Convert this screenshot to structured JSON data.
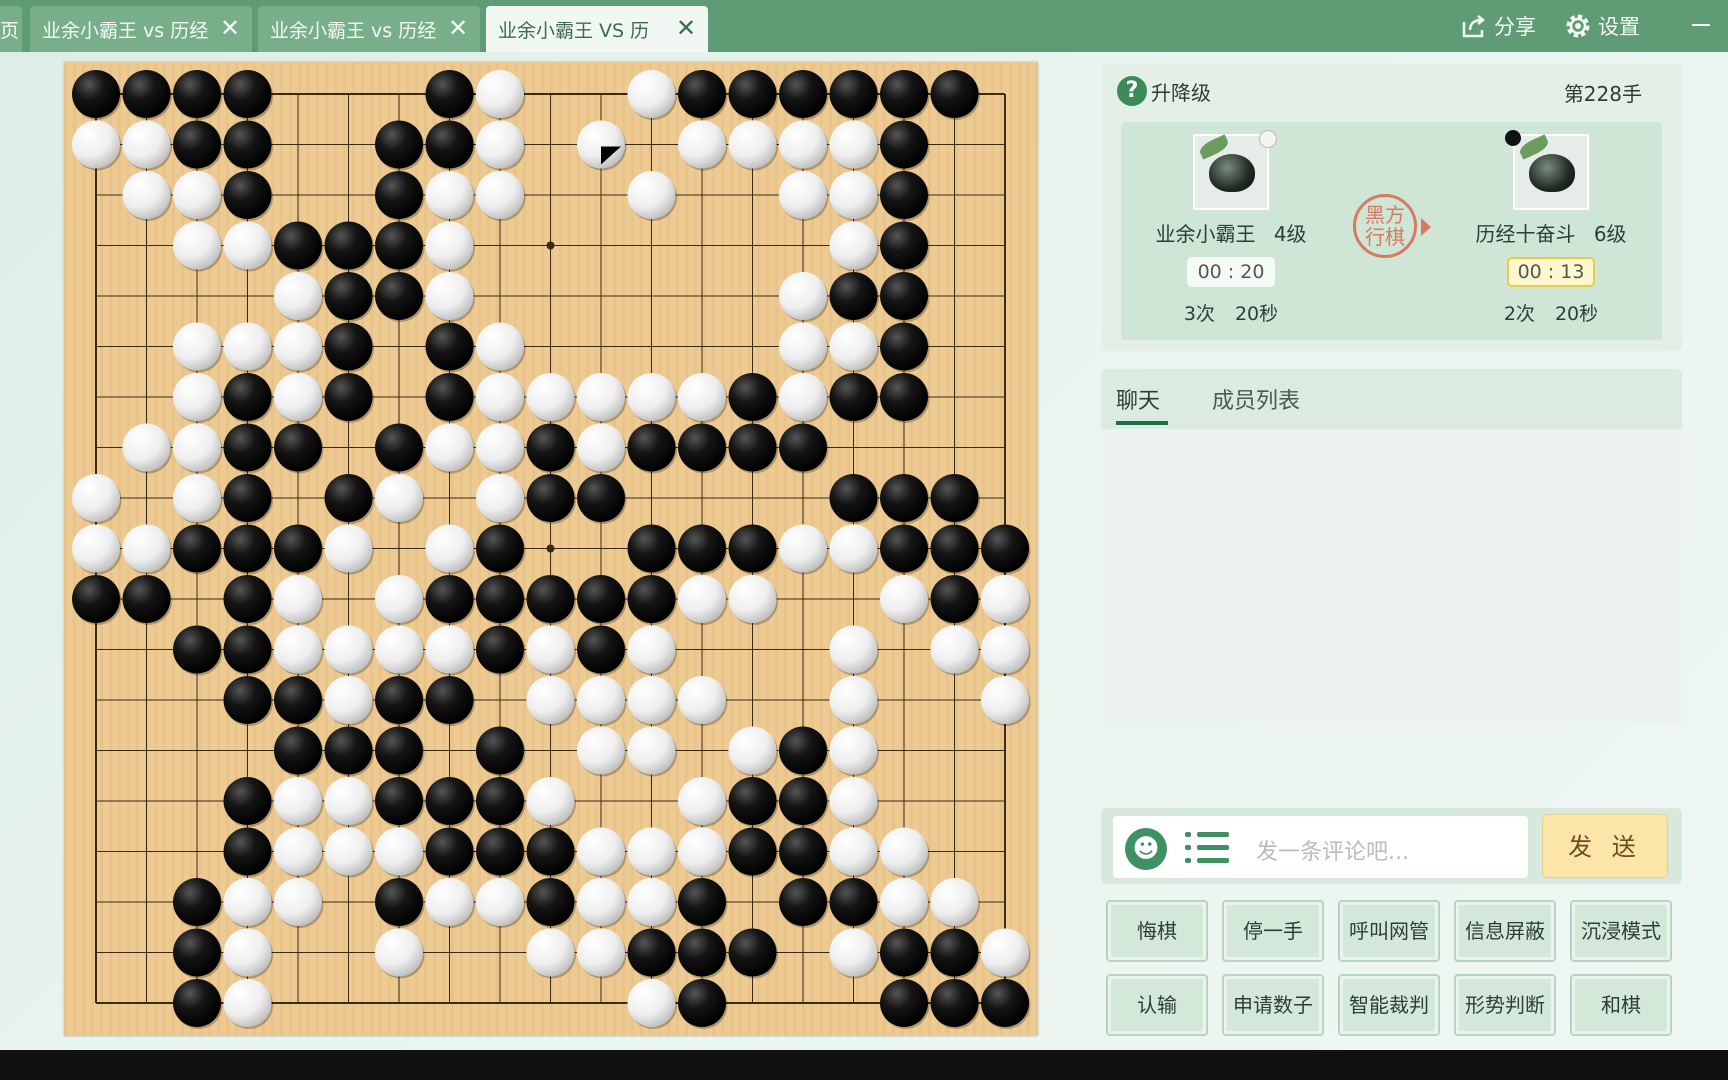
{
  "tabs": [
    {
      "label": "页"
    },
    {
      "label": "业余小霸王 vs 历经",
      "close": "✕"
    },
    {
      "label": "业余小霸王 vs 历经",
      "close": "✕"
    },
    {
      "label": "业余小霸王 VS 历",
      "close": "✕",
      "active": true
    }
  ],
  "toolbar": {
    "share": "分享",
    "settings": "设置"
  },
  "game": {
    "level_title": "升降级",
    "move": "第228手",
    "turn_seal": "黑方\n行棋",
    "players": [
      {
        "name": "业余小霸王",
        "rank": "4级",
        "color": "white",
        "time": "00 : 20",
        "byo_count": "3次",
        "byo_time": "20秒"
      },
      {
        "name": "历经十奋斗",
        "rank": "6级",
        "color": "black",
        "time": "00 : 13",
        "byo_count": "2次",
        "byo_time": "20秒"
      }
    ],
    "board": {
      "size": 19,
      "last_move": "L18",
      "rows": [
        "XXXX...XO..OXXXXXX.",
        "OOXX..XXO.O.OOOOX..",
        ".OOX..XOO..O..OOX..",
        "..OOXXXO.......OX..",
        "....OXXO......OXX..",
        "..OOOX.XO.....OOX..",
        "..OXOX.XOOOOOXOXX..",
        ".OOXX.XOOXOXXXX....",
        "O.OX.XO.OXX....XXX.",
        "OOXXXO.OX..XXXOOXXX",
        "XX.XO.OXXXXXOO..OXO",
        "..XXOOOOXOXO...O.OO",
        "...XXOXX.OOOO..O..O",
        "....XXX.X.OO.OXO...",
        "...XOOXXXO..OXXO...",
        "...XOOOXXXOOOXXOO..",
        "..XOO.XOOXOOX.XXOO.",
        "..XO..O..OOXXX.OXXOO",
        "..XO.......OX...XXXO"
      ]
    }
  },
  "chat": {
    "tab_chat": "聊天",
    "tab_members": "成员列表",
    "placeholder": "发一条评论吧...",
    "send": "发 送"
  },
  "actions": [
    {
      "label": "悔棋"
    },
    {
      "label": "停一手"
    },
    {
      "label": "呼叫网管"
    },
    {
      "label": "信息屏蔽"
    },
    {
      "label": "沉浸模式"
    },
    {
      "label": "认输"
    },
    {
      "label": "申请数子"
    },
    {
      "label": "智能裁判"
    },
    {
      "label": "形势判断"
    },
    {
      "label": "和棋"
    }
  ],
  "colors": {
    "accent": "#5f9b74",
    "board": "#ecc98f",
    "timer_highlight": "#e8cc44",
    "seal": "#d77a60"
  }
}
